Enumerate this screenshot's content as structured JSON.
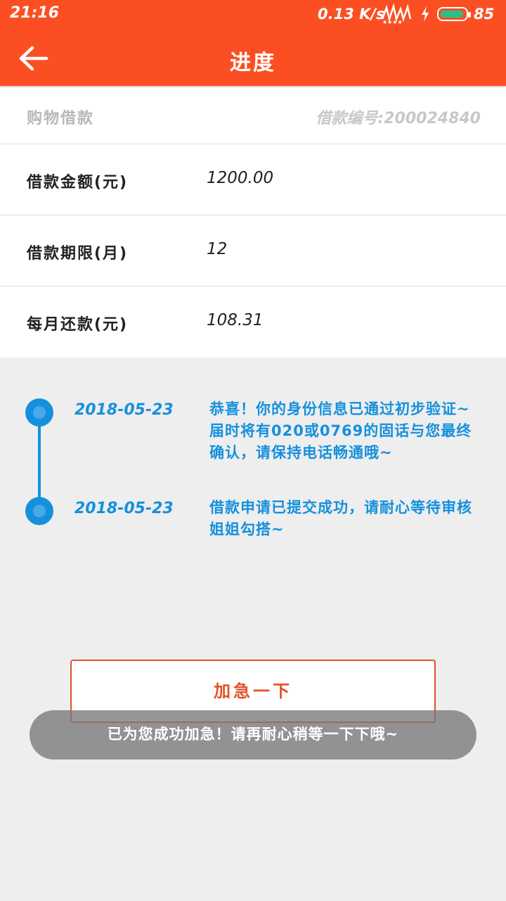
{
  "status_bar": {
    "time": "21:16",
    "net_speed": "0.13 K/s",
    "battery_level": "85",
    "colors": {
      "background": "#fb4f23",
      "battery_fill": "#25c28a"
    }
  },
  "app_bar": {
    "back_icon": "arrow-left-icon",
    "title": "进度"
  },
  "loan_info": {
    "type": "购物借款",
    "number": "借款编号:200024840",
    "rows": [
      {
        "label": "借款金额(元)",
        "value": "1200.00"
      },
      {
        "label": "借款期限(月)",
        "value": "12"
      },
      {
        "label": "每月还款(元)",
        "value": "108.31"
      }
    ]
  },
  "timeline": {
    "color": "#1590dd",
    "items": [
      {
        "date": "2018-05-23",
        "text": "恭喜！你的身份信息已通过初步验证~届时将有020或0769的固话与您最终确认，请保持电话畅通哦~"
      },
      {
        "date": "2018-05-23",
        "text": "借款申请已提交成功，请耐心等待审核姐姐勾搭~"
      }
    ]
  },
  "urgent_button": {
    "label": "加急一下",
    "color": "#e25025"
  },
  "toast": {
    "text": "已为您成功加急！请再耐心稍等一下下哦~"
  }
}
